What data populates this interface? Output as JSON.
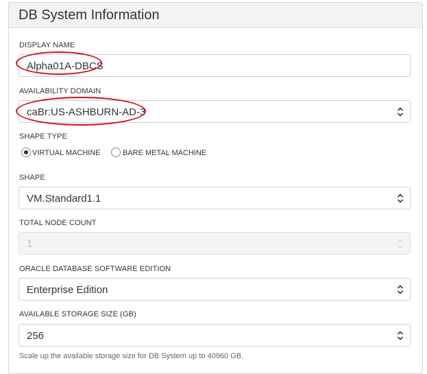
{
  "panel": {
    "title": "DB System Information"
  },
  "display_name": {
    "label": "DISPLAY NAME",
    "value": "Alpha01A-DBCS"
  },
  "availability_domain": {
    "label": "AVAILABILITY DOMAIN",
    "value": "caBr:US-ASHBURN-AD-3"
  },
  "shape_type": {
    "label": "SHAPE TYPE",
    "options": [
      "VIRTUAL MACHINE",
      "BARE METAL MACHINE"
    ],
    "selected": "VIRTUAL MACHINE"
  },
  "shape": {
    "label": "SHAPE",
    "value": "VM.Standard1.1"
  },
  "total_node_count": {
    "label": "TOTAL NODE COUNT",
    "value": "1"
  },
  "software_edition": {
    "label": "ORACLE DATABASE SOFTWARE EDITION",
    "value": "Enterprise Edition"
  },
  "storage_size": {
    "label": "AVAILABLE STORAGE SIZE (GB)",
    "value": "256",
    "hint": "Scale up the available storage size for DB System up to 40960 GB."
  },
  "annotation_color": "#d3101a"
}
